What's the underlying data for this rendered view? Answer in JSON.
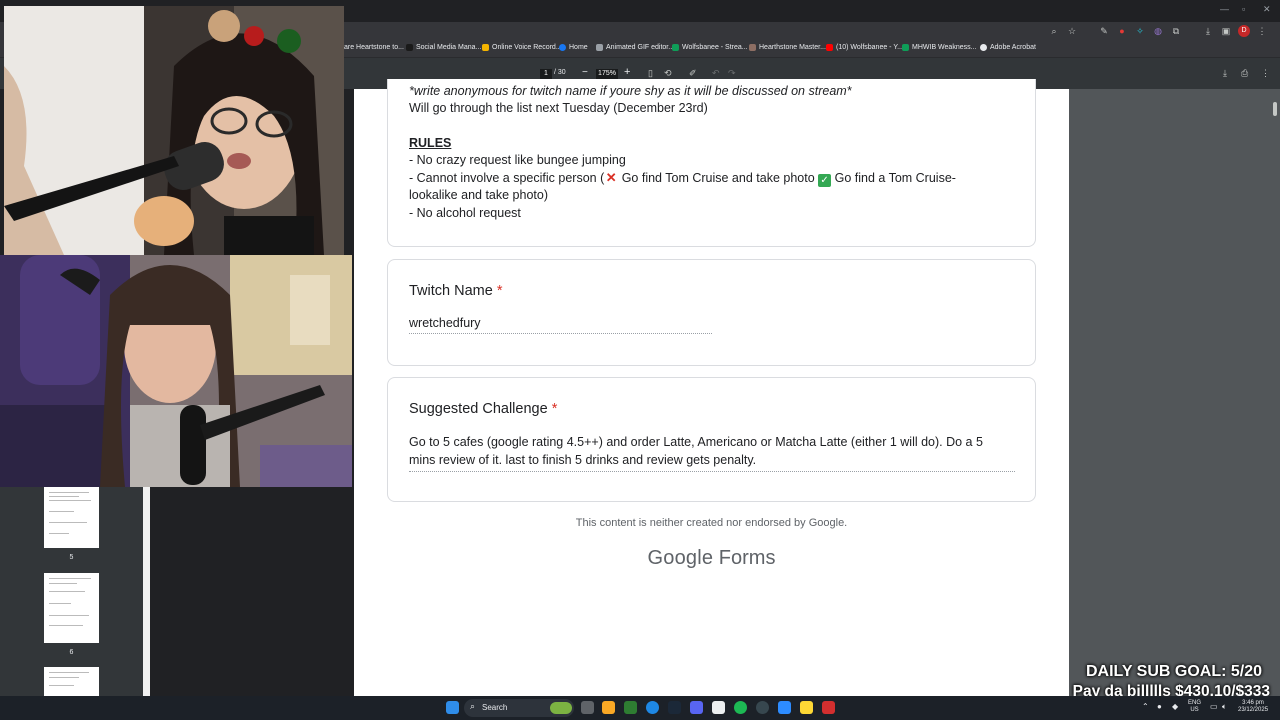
{
  "browser": {
    "url_fragment": "f",
    "bookmarks": [
      "are Heartstone to...",
      "Social Media Mana...",
      "Online Voice Record...",
      "Home",
      "Animated GIF editor...",
      "Wolfsbanee - Strea...",
      "Hearthstone Master...",
      "(10) Wolfsbanee - Y...",
      "MHWIB Weakness...",
      "Adobe Acrobat"
    ],
    "profile_letter": "D"
  },
  "pdf_toolbar": {
    "page_current": "1",
    "page_total": "/ 30",
    "zoom": "175%",
    "minus": "−",
    "plus": "+"
  },
  "form": {
    "intro_line1": "*write anonymous for twitch name if youre shy as it will be discussed on stream*",
    "intro_line2": "Will go through the list next Tuesday (December 23rd)",
    "rules_heading": "RULES",
    "rule1": "- No crazy request like bungee jumping",
    "rule2_a": "- Cannot involve a specific person (",
    "rule2_b": " Go find Tom Cruise and take photo ",
    "rule2_c": " Go find a Tom Cruise-",
    "rule2_d": "lookalike and take photo)",
    "rule3": "- No alcohol request",
    "q1_title": "Twitch Name",
    "q1_answer": "wretchedfury",
    "q2_title": "Suggested Challenge",
    "q2_answer_line1": "Go to 5 cafes (google rating 4.5++) and order Latte, Americano or Matcha Latte (either 1 will do). Do a 5",
    "q2_answer_line2": "mins review of it. last to finish 5 drinks and review gets penalty.",
    "required_mark": "*",
    "footer_note": "This content is neither created nor endorsed by Google.",
    "brand_google": "Google",
    "brand_forms": "Forms"
  },
  "thumbnails": {
    "labels": [
      "5",
      "6"
    ]
  },
  "overlay": {
    "sub_goal": "DAILY SUB GOAL: 5/20",
    "bills": "Pay da billllls $430.10/$333"
  },
  "taskbar": {
    "search_label": "Search",
    "lang_top": "ENG",
    "lang_bottom": "US",
    "time": "3:46 pm",
    "date": "23/12/2025"
  }
}
